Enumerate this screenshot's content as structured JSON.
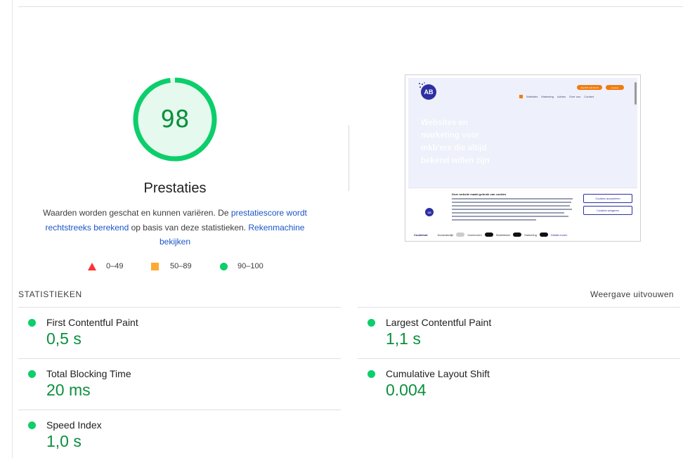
{
  "score": {
    "value": "98",
    "fraction": 0.98,
    "title": "Prestaties",
    "color": "#0cce6b"
  },
  "description": {
    "text_before": "Waarden worden geschat en kunnen variëren. De ",
    "link1": "prestatiescore wordt rechtstreeks berekend",
    "text_middle": " op basis van deze statistieken. ",
    "link2": "Rekenmachine bekijken"
  },
  "legend": [
    {
      "shape": "triangle",
      "color": "#ff3333",
      "label": "0–49"
    },
    {
      "shape": "square",
      "color": "#ffaa33",
      "label": "50–89"
    },
    {
      "shape": "circle",
      "color": "#0cce6b",
      "label": "90–100"
    }
  ],
  "thumbnail": {
    "logo": "AB",
    "phone_pill": "062 875 423 50 00",
    "cta_pill": "Contact",
    "nav": [
      "Websites",
      "Marketing",
      "Advies",
      "Over ons",
      "Contact"
    ],
    "hero": "Websites en marketing voor mkb'ers die altijd bekend willen zijn",
    "cookie_title": "Deze website maakt gebruik van cookies",
    "accept_button": "Cookies accepteren",
    "reject_button": "Cookies weigeren",
    "powered_by": "Cookiebot",
    "toggles": [
      "Noodzakelijk",
      "Voorkeuren",
      "Statistieken",
      "Marketing"
    ],
    "details": "Details tonen"
  },
  "statistics": {
    "header": "STATISTIEKEN",
    "expand_label": "Weergave uitvouwen",
    "metrics": [
      {
        "name": "First Contentful Paint",
        "value": "0,5 s",
        "status": "good"
      },
      {
        "name": "Largest Contentful Paint",
        "value": "1,1 s",
        "status": "good"
      },
      {
        "name": "Total Blocking Time",
        "value": "20 ms",
        "status": "good"
      },
      {
        "name": "Cumulative Layout Shift",
        "value": "0.004",
        "status": "good"
      },
      {
        "name": "Speed Index",
        "value": "1,0 s",
        "status": "good"
      }
    ]
  },
  "colors": {
    "good_dot": "#0cce6b",
    "good_text": "#0c8f3d",
    "link": "#1a56c7"
  }
}
